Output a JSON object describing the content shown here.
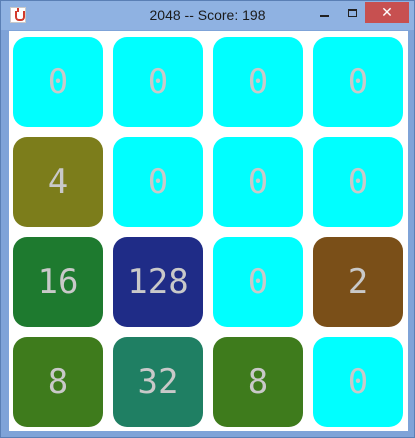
{
  "window": {
    "title": "2048 -- Score: 198",
    "app_icon": "java-cup-icon",
    "close_glyph": "✕"
  },
  "board": {
    "size": 4,
    "tiles": [
      {
        "value": "0",
        "color": "#00ffff"
      },
      {
        "value": "0",
        "color": "#00ffff"
      },
      {
        "value": "0",
        "color": "#00ffff"
      },
      {
        "value": "0",
        "color": "#00ffff"
      },
      {
        "value": "4",
        "color": "#7c7d1b"
      },
      {
        "value": "0",
        "color": "#00ffff"
      },
      {
        "value": "0",
        "color": "#00ffff"
      },
      {
        "value": "0",
        "color": "#00ffff"
      },
      {
        "value": "16",
        "color": "#1e7a2f"
      },
      {
        "value": "128",
        "color": "#1f2c87"
      },
      {
        "value": "0",
        "color": "#00ffff"
      },
      {
        "value": "2",
        "color": "#7a4f18"
      },
      {
        "value": "8",
        "color": "#3e7b1c"
      },
      {
        "value": "32",
        "color": "#1f7f63"
      },
      {
        "value": "8",
        "color": "#3e7b1c"
      },
      {
        "value": "0",
        "color": "#00ffff"
      }
    ]
  }
}
